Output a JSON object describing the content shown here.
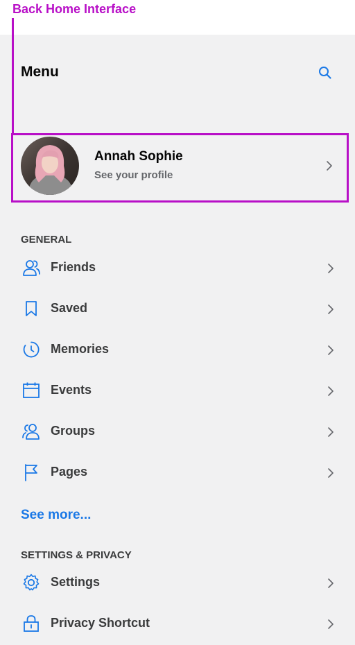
{
  "annotation": {
    "label": "Back Home Interface",
    "color": "#b80fc7"
  },
  "header": {
    "title": "Menu",
    "search_icon": "search-icon"
  },
  "profile": {
    "name": "Annah Sophie",
    "subtitle": "See your profile"
  },
  "general": {
    "heading": "GENERAL",
    "items": [
      {
        "label": "Friends",
        "icon": "friends-icon"
      },
      {
        "label": "Saved",
        "icon": "bookmark-icon"
      },
      {
        "label": "Memories",
        "icon": "clock-icon"
      },
      {
        "label": "Events",
        "icon": "calendar-icon"
      },
      {
        "label": "Groups",
        "icon": "groups-icon"
      },
      {
        "label": "Pages",
        "icon": "flag-icon"
      }
    ],
    "see_more": "See more..."
  },
  "settings_privacy": {
    "heading": "SETTINGS & PRIVACY",
    "items": [
      {
        "label": "Settings",
        "icon": "gear-icon"
      },
      {
        "label": "Privacy Shortcut",
        "icon": "lock-icon"
      }
    ]
  },
  "colors": {
    "accent": "#1a78e6",
    "background": "#f1f1f2",
    "annotation": "#b80fc7"
  }
}
